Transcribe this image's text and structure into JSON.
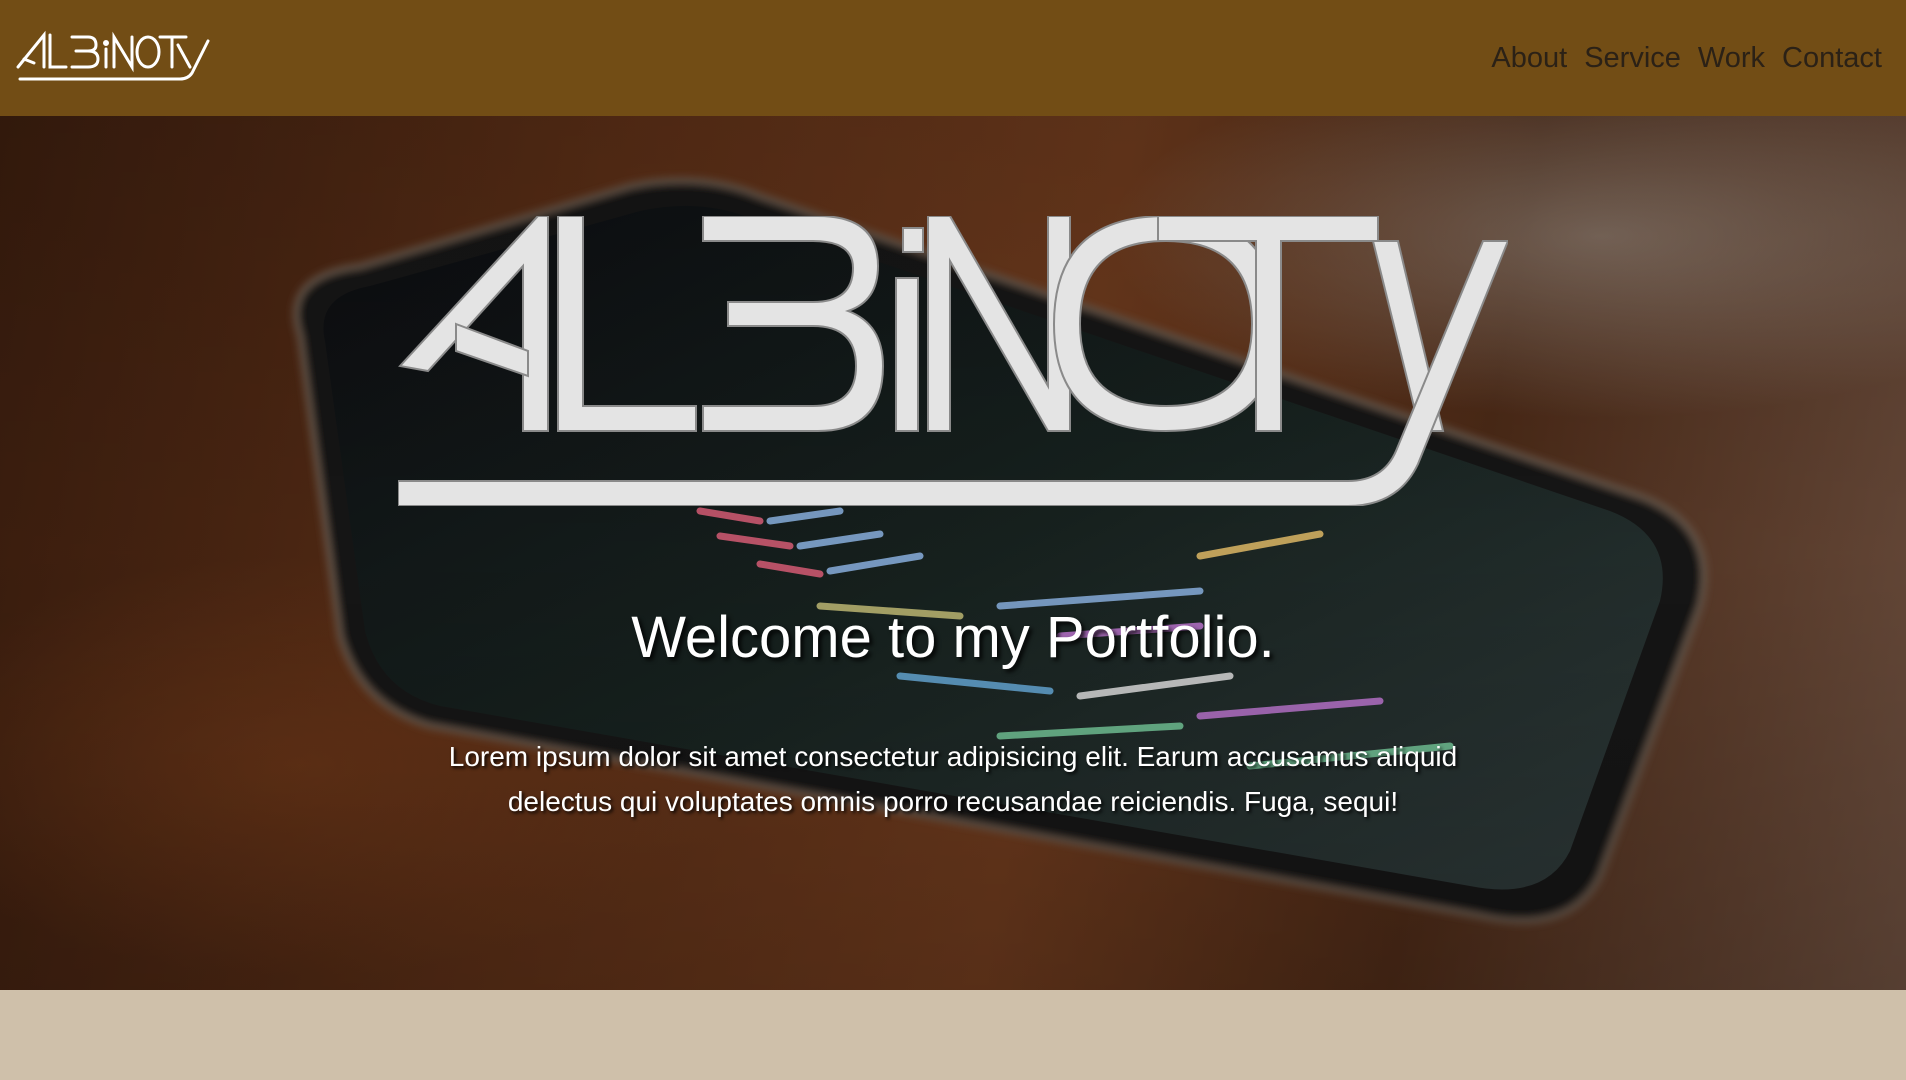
{
  "navbar": {
    "logo_text": "ALBiNOTy",
    "links": [
      {
        "label": "About"
      },
      {
        "label": "Service"
      },
      {
        "label": "Work"
      },
      {
        "label": "Contact"
      }
    ]
  },
  "hero": {
    "logo_text": "ALBiNOTy",
    "title": "Welcome to my Portfolio.",
    "text": "Lorem ipsum dolor sit amet consectetur adipisicing elit. Earum accusamus aliquid delectus qui voluptates omnis porro recusandae reiciendis. Fuga, sequi!"
  },
  "colors": {
    "navbar_bg": "#724d15",
    "nav_link": "#2b2116",
    "page_bg": "#cfc0aa",
    "logo_fill": "#e4e4e4"
  }
}
